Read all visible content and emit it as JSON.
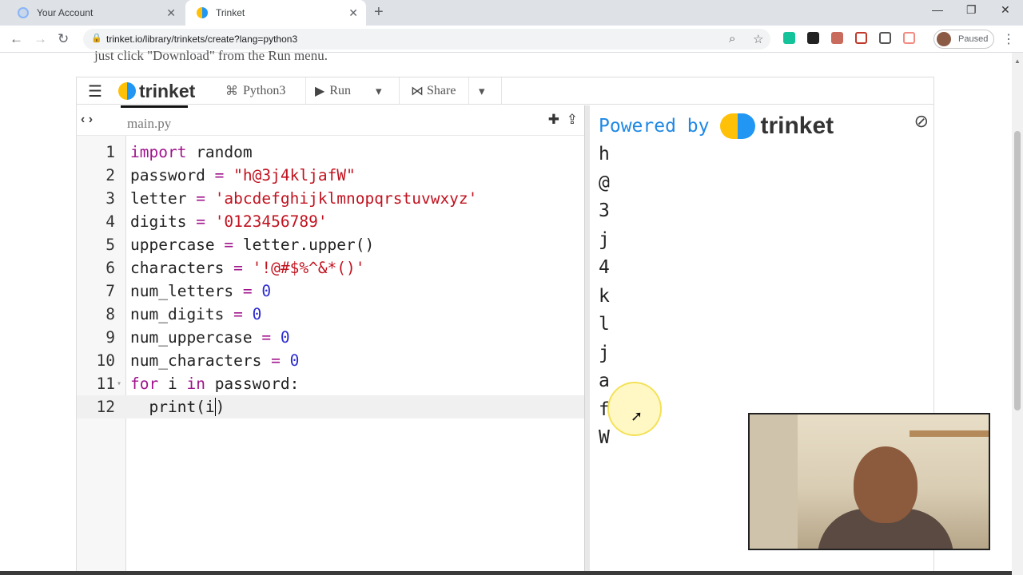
{
  "browser": {
    "tabs": [
      {
        "title": "Your Account",
        "active": false
      },
      {
        "title": "Trinket",
        "active": true
      }
    ],
    "url": "trinket.io/library/trinkets/create?lang=python3",
    "profile_status": "Paused",
    "accent_colors": {
      "trinket_yellow": "#ffc107",
      "trinket_blue": "#2196f3"
    }
  },
  "page": {
    "cut_off_text": "just click \"Download\" from the Run menu."
  },
  "trinket": {
    "menu_icon": "hamburger-icon",
    "brand": "trinket",
    "language": "Python3",
    "run_label": "Run",
    "share_label": "Share",
    "file_tab": "main.py",
    "code_lines": [
      {
        "n": "1",
        "html": "<span class=\"kw\">import</span> random"
      },
      {
        "n": "2",
        "html": "password <span class=\"op\">=</span> <span class=\"str\">\"h@3j4kljafW\"</span>"
      },
      {
        "n": "3",
        "html": "letter <span class=\"op\">=</span> <span class=\"str\">'abcdefghijklmnopqrstuvwxyz'</span>"
      },
      {
        "n": "4",
        "html": "digits <span class=\"op\">=</span> <span class=\"str\">'0123456789'</span>"
      },
      {
        "n": "5",
        "html": "uppercase <span class=\"op\">=</span> letter.upper()"
      },
      {
        "n": "6",
        "html": "characters <span class=\"op\">=</span> <span class=\"str\">'!@#$%^&amp;*()'</span>"
      },
      {
        "n": "7",
        "html": "num_letters <span class=\"op\">=</span> <span class=\"num\">0</span>"
      },
      {
        "n": "8",
        "html": "num_digits <span class=\"op\">=</span> <span class=\"num\">0</span>"
      },
      {
        "n": "9",
        "html": "num_uppercase <span class=\"op\">=</span> <span class=\"num\">0</span>"
      },
      {
        "n": "10",
        "html": "num_characters <span class=\"op\">=</span> <span class=\"num\">0</span>"
      },
      {
        "n": "11",
        "html": "<span class=\"kw\">for</span> i <span class=\"kw\">in</span> password:",
        "fold": true
      },
      {
        "n": "12",
        "html": "  print(i<span class=\"caret\"></span>)",
        "active": true
      }
    ],
    "powered_by": "Powered by",
    "output_lines": [
      "h",
      "@",
      "3",
      "j",
      "4",
      "k",
      "l",
      "j",
      "a",
      "f",
      "W"
    ]
  }
}
